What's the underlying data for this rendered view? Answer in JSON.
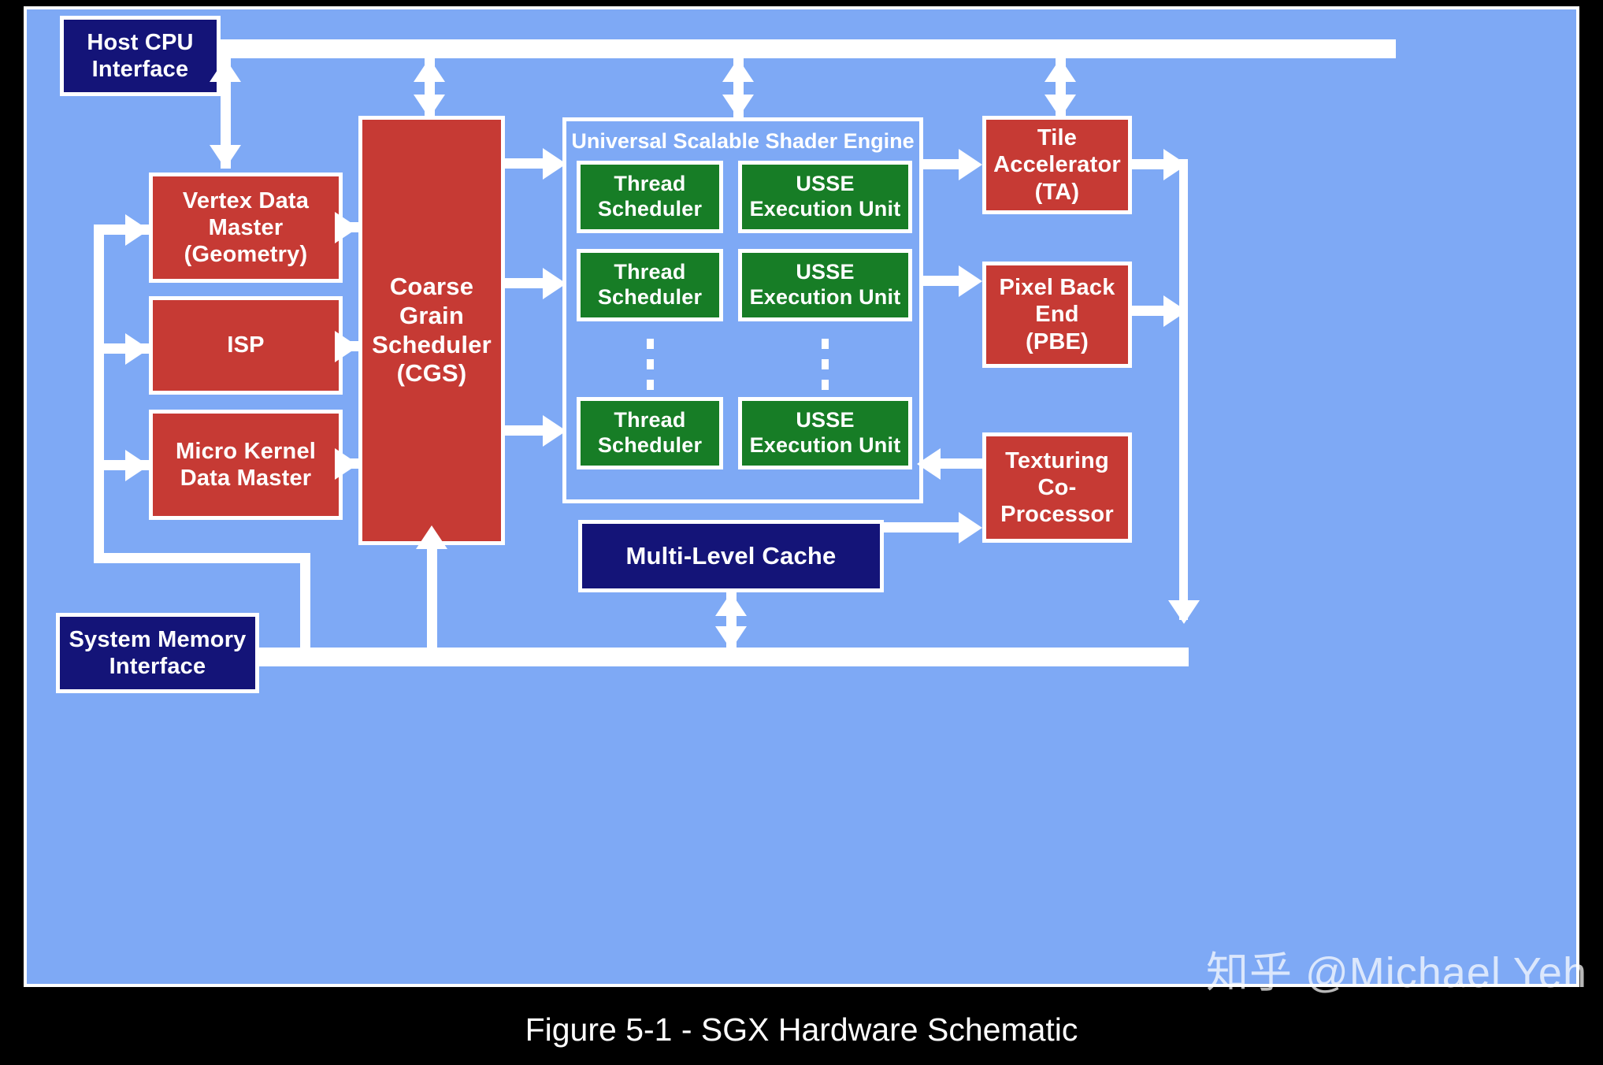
{
  "figure": {
    "caption": "Figure 5-1 - SGX Hardware Schematic",
    "watermark": "知乎 @Michael Yeh"
  },
  "colors": {
    "background": "#7ea9f5",
    "navy": "#141478",
    "red": "#c63a34",
    "green": "#177d26",
    "line": "#ffffff",
    "caption_bar": "#000000"
  },
  "blocks": {
    "host_cpu_interface": "Host CPU\nInterface",
    "system_memory_interface": "System Memory\nInterface",
    "vertex_data_master": "Vertex Data\nMaster\n(Geometry)",
    "isp": "ISP",
    "micro_kernel_data_master": "Micro Kernel\nData Master",
    "coarse_grain_scheduler": "Coarse\nGrain\nScheduler\n(CGS)",
    "tile_accelerator": "Tile\nAccelerator\n(TA)",
    "pixel_back_end": "Pixel Back\nEnd\n(PBE)",
    "texturing_co_processor": "Texturing\nCo-\nProcessor",
    "multi_level_cache": "Multi-Level Cache"
  },
  "usse": {
    "title": "Universal Scalable Shader Engine",
    "rows": [
      {
        "scheduler": "Thread\nScheduler",
        "unit": "USSE\nExecution Unit"
      },
      {
        "scheduler": "Thread\nScheduler",
        "unit": "USSE\nExecution Unit"
      },
      {
        "scheduler": "Thread\nScheduler",
        "unit": "USSE\nExecution Unit"
      }
    ],
    "continuation_marker": "vertical-dotted-ellipsis"
  },
  "connections": {
    "top_bus_label": "host-cpu-bus",
    "bottom_bus_label": "system-memory-bus"
  }
}
